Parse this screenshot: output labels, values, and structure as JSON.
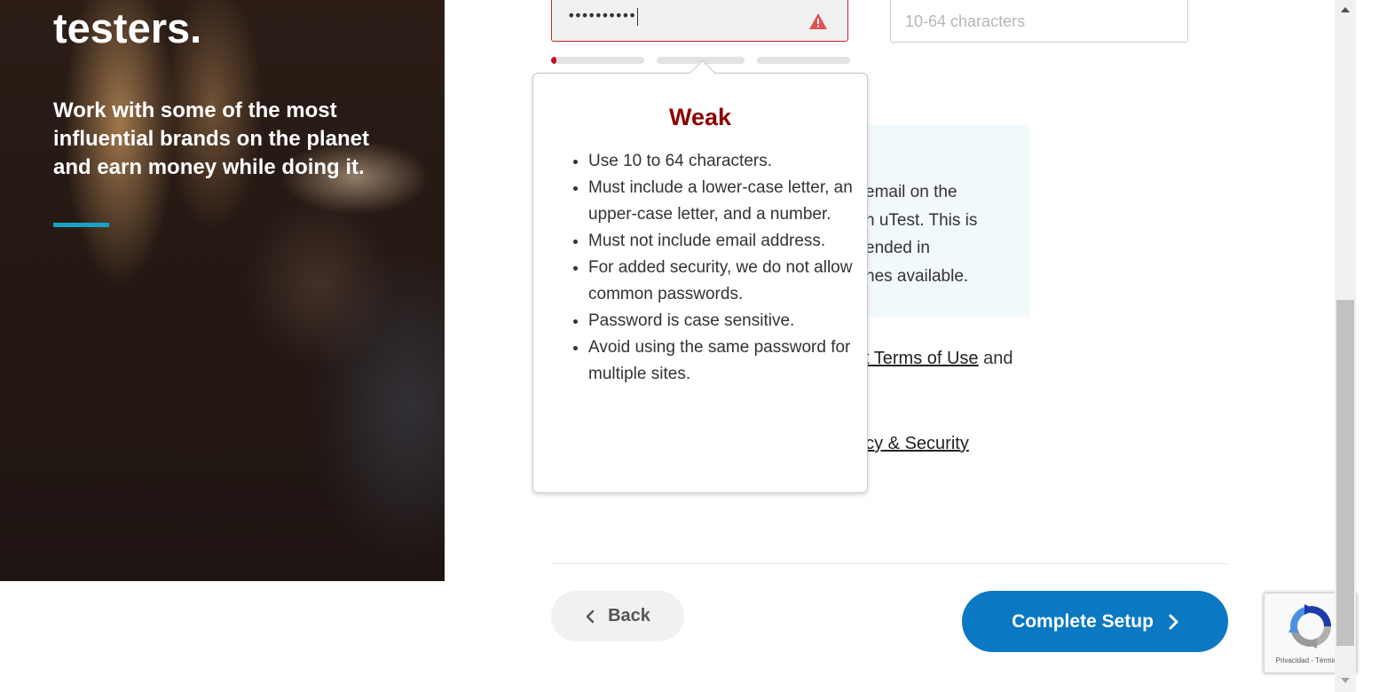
{
  "hero": {
    "title": "testers.",
    "subtitle": "Work with some of the most influential brands on the planet and earn money while doing it."
  },
  "form": {
    "password": {
      "masked_value": "••••••••••",
      "status_icon": "warning-triangle-icon",
      "error_color": "#d0212c"
    },
    "confirm_password": {
      "placeholder": "10-64 characters"
    },
    "strength": {
      "segments": 3,
      "filled_fraction_of_first": 0.06,
      "color": "#c1121f"
    }
  },
  "popover": {
    "title": "Weak",
    "title_color": "#8b0000",
    "rules": [
      "Use 10 to 64 characters.",
      "Must include a lower-case letter, an upper-case letter, and a number.",
      "Must not include email address.",
      "For added security, we do not allow common passwords.",
      "Password is case sensitive.",
      "Avoid using the same password for multiple sites."
    ]
  },
  "info_box": {
    "lines": [
      "email on the",
      "n uTest. This is",
      "ended in",
      "nes available."
    ]
  },
  "terms": {
    "link_text": "st Terms of Use",
    "trailing_text": " and"
  },
  "privacy": {
    "link_text": "acy & Security"
  },
  "footer": {
    "back_label": "Back",
    "complete_label": "Complete Setup",
    "accent_color": "#0a78c2"
  },
  "recaptcha": {
    "links_text": "Privacidad - Términos"
  }
}
